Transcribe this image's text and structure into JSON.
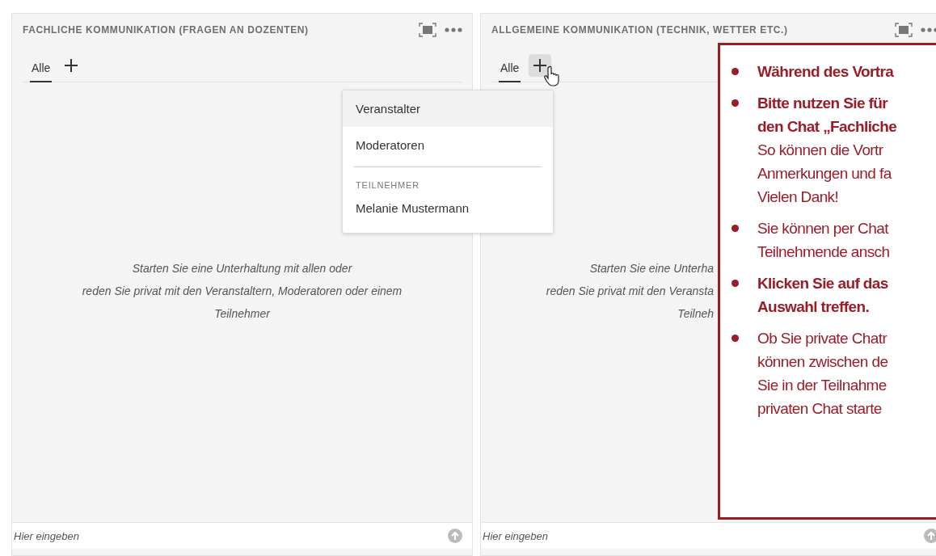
{
  "panels": [
    {
      "title": "FACHLICHE KOMMUNIKATION (FRAGEN AN DOZENTEN)",
      "tabs": [
        {
          "label": "Alle",
          "selected": true
        }
      ],
      "add_hovered": false,
      "empty_lines": [
        "Starten Sie eine Unterhaltung mit allen oder",
        "reden Sie privat mit den Veranstaltern, Moderatoren oder einem",
        "Teilnehmer"
      ],
      "input": {
        "placeholder": "Hier eingeben"
      },
      "menu": {
        "items": [
          {
            "label": "Veranstalter",
            "selected": true
          },
          {
            "label": "Moderatoren",
            "selected": false
          }
        ],
        "section": "TEILNEHMER",
        "people": [
          {
            "label": "Melanie Mustermann",
            "selected": false
          }
        ]
      }
    },
    {
      "title": "ALLGEMEINE KOMMUNIKATION (TECHNIK, WETTER ETC.)",
      "tabs": [
        {
          "label": "Alle",
          "selected": true
        }
      ],
      "add_hovered": true,
      "empty_lines": [
        "Starten Sie eine Unterha",
        "reden Sie privat mit den Veransta",
        "Teilneh"
      ],
      "input": {
        "placeholder": "Hier eingeben"
      }
    }
  ],
  "callout": {
    "bullets": [
      {
        "lines": [
          {
            "text": "Während des Vortra",
            "bold": true
          }
        ]
      },
      {
        "lines": [
          {
            "text": "Bitte nutzen Sie für",
            "bold": true
          },
          {
            "text": "den Chat „Fachliche",
            "bold": true
          },
          {
            "text": "So können die Vortr",
            "bold": false
          },
          {
            "text": "Anmerkungen und fa",
            "bold": false
          },
          {
            "text": "Vielen Dank!",
            "bold": false
          }
        ]
      },
      {
        "lines": [
          {
            "text": "Sie können per Chat",
            "bold": false
          },
          {
            "text": "Teilnehmende ansch",
            "bold": false
          }
        ]
      },
      {
        "lines": [
          {
            "text": "Klicken Sie auf das",
            "bold": true
          },
          {
            "text": "Auswahl treffen.",
            "bold": true
          }
        ]
      },
      {
        "lines": [
          {
            "text": "Ob Sie private Chatr",
            "bold": false
          },
          {
            "text": "können zwischen de",
            "bold": false
          },
          {
            "text": "Sie in der Teilnahme",
            "bold": false
          },
          {
            "text": "privaten Chat starte",
            "bold": false
          }
        ]
      }
    ]
  }
}
